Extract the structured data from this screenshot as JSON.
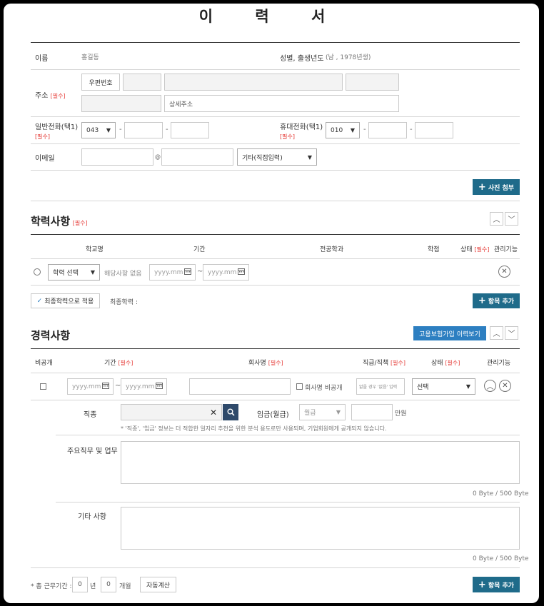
{
  "title": "이   력   서",
  "personal": {
    "name_label": "이름",
    "name_value": "홍길동",
    "gender_label": "성별, 출생년도",
    "gender_value": "(남 , 1978년생)",
    "address_label": "주소",
    "required": "[필수]",
    "zipcode_button": "우편번호",
    "detail_address_placeholder": "상세주소",
    "phone_label": "일반전화(택1)",
    "phone_area": "043",
    "mobile_label": "휴대전화(택1)",
    "mobile_prefix": "010",
    "email_label": "이메일",
    "email_at": "@",
    "email_domain": "기타(직접입력)",
    "photo_button": "사진 첨부"
  },
  "education": {
    "header": "학력사항",
    "required": "[필수]",
    "columns": {
      "school": "학교명",
      "period": "기간",
      "major": "전공학과",
      "grade": "학점",
      "status": "상태",
      "manage": "관리기능"
    },
    "school_select": "학력 선택",
    "none_text": "해당사항 없음",
    "date_placeholder": "yyyy.mm",
    "tilde": "~",
    "apply_button": "최종학력으로 적용",
    "final_label": "최종학력 :",
    "add_button": "항목 추가"
  },
  "career": {
    "header": "경력사항",
    "insurance_button": "고용보험가입 이력보기",
    "columns": {
      "private": "비공개",
      "period": "기간",
      "company": "회사명",
      "position": "직급/직책",
      "status": "상태",
      "manage": "관리기능"
    },
    "required": "[필수]",
    "date_placeholder": "yyyy.mm",
    "tilde": "~",
    "company_private": "회사명 비공개",
    "position_placeholder": "없을 경우 '없음' 입력",
    "status_select": "선택",
    "job_type_label": "직종",
    "wage_label": "임금(월급)",
    "wage_select": "월급",
    "wage_unit": "만원",
    "notice": "* '직종', '임금' 정보는 더 적합한 일자리 추천을 위한 분석 용도로만 사용되며, 기업회원에게 공개되지 않습니다.",
    "duty_label": "주요직무 및 업무",
    "etc_label": "기타 사항",
    "byte_count": "0 Byte / 500 Byte",
    "total_label": "* 총 근무기간 :",
    "years_value": "0",
    "years_unit": "년",
    "months_value": "0",
    "months_unit": "개월",
    "auto_calc": "자동계산",
    "add_button": "항목 추가"
  }
}
